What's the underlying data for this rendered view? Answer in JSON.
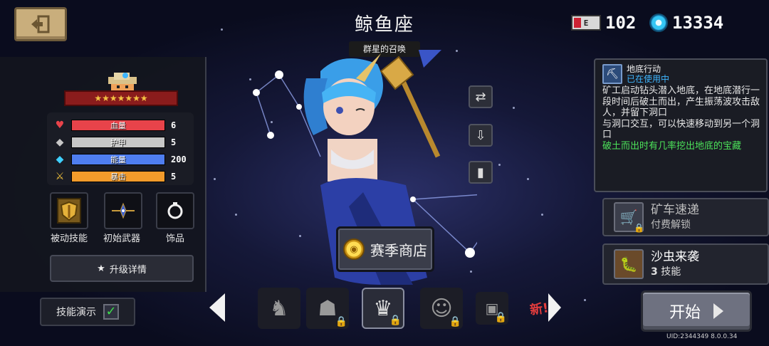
{
  "header": {
    "title": "鲸鱼座",
    "subtitle": "群星的召唤",
    "energy_value": "102",
    "gems_value": "13334"
  },
  "character": {
    "stars": "★★★★★★★",
    "stats": [
      {
        "label": "血量",
        "value": "6",
        "fill": 1.0,
        "color": "#e8434a",
        "icon": "heart-icon"
      },
      {
        "label": "护甲",
        "value": "5",
        "fill": 1.0,
        "color": "#c7c7c7",
        "icon": "shield-icon"
      },
      {
        "label": "能量",
        "value": "200",
        "fill": 1.0,
        "color": "#4f7ef0",
        "icon": "energy-crystal-icon"
      },
      {
        "label": "暴击",
        "value": "5",
        "fill": 1.0,
        "color": "#f29b2b",
        "icon": "crit-icon"
      }
    ],
    "slots": {
      "passive": "被动技能",
      "weapon": "初始武器",
      "accessory": "饰品"
    },
    "upgrade_label": "升级详情",
    "demo_label": "技能演示"
  },
  "skill": {
    "name": "地底行动",
    "status": "已在使用中",
    "desc": "矿工启动钻头潜入地底，在地底潜行一段时间后破土而出，产生振荡波攻击敌人，并留下洞口",
    "desc2": "与洞口交互，可以快速移动到另一个洞口",
    "desc_green": "破土而出时有几率挖出地底的宝藏"
  },
  "alt_skills": [
    {
      "name": "矿车速递",
      "sub": "付费解锁"
    },
    {
      "name": "沙虫来袭",
      "sub_num": "3",
      "sub": "技能"
    }
  ],
  "shop_label": "赛季商店",
  "start_label": "开始",
  "new_badge": "新!",
  "uid": "UID:2344349 8.0.0.34",
  "colors": {
    "accent_blue": "#3fb6ff",
    "highlight_green": "#4ce35a",
    "ribbon_red": "#8a1c1c",
    "back_button": "#c9ae7c"
  }
}
